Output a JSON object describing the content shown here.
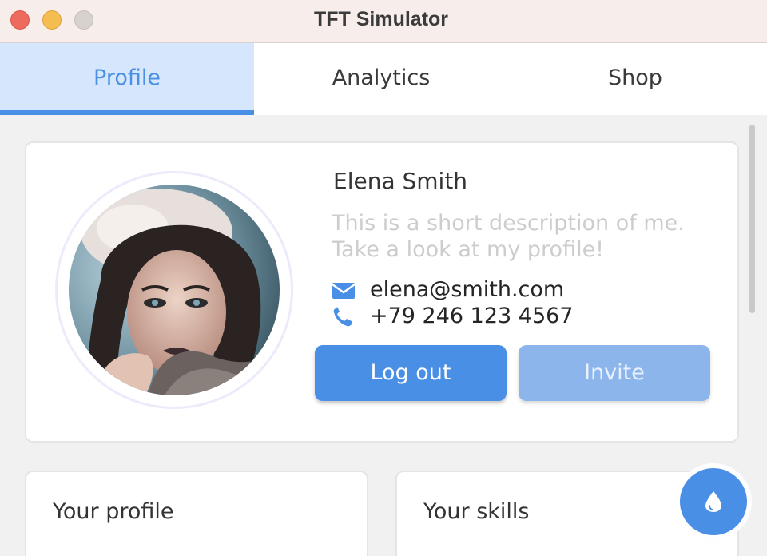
{
  "window": {
    "title": "TFT Simulator"
  },
  "tabs": [
    {
      "label": "Profile",
      "active": true
    },
    {
      "label": "Analytics",
      "active": false
    },
    {
      "label": "Shop",
      "active": false
    }
  ],
  "profile": {
    "name": "Elena Smith",
    "description": "This is a short description of me.\n Take a look at my profile!",
    "email": "elena@smith.com",
    "phone": "+79 246 123 4567",
    "avatar_icon": "user-photo",
    "email_icon": "envelope-icon",
    "phone_icon": "phone-icon",
    "buttons": {
      "logout": "Log out",
      "invite": "Invite"
    }
  },
  "cards": {
    "your_profile": "Your profile",
    "your_skills": "Your skills"
  },
  "fab": {
    "icon": "water-drop-icon"
  },
  "colors": {
    "accent": "#4a8fe6",
    "accent_light": "#d6e7fd",
    "disabled_button": "#8cb6eb",
    "muted_text": "#cdcdcd"
  }
}
